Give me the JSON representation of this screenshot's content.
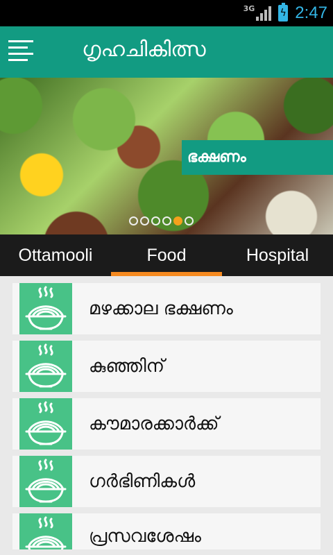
{
  "status_bar": {
    "network": "3G",
    "time": "2:47",
    "icons": [
      "signal-icon",
      "battery-charging-icon"
    ]
  },
  "app_bar": {
    "title": "ഗൃഹചികിത്സ",
    "menu_icon": "hamburger-menu-icon",
    "color": "#129b82"
  },
  "banner": {
    "tag": "ഭക്ഷണം",
    "slide_count": 6,
    "active_slide": 5
  },
  "tabs": [
    {
      "label": "Ottamooli",
      "active": false
    },
    {
      "label": "Food",
      "active": true
    },
    {
      "label": "Hospital",
      "active": false
    }
  ],
  "accent": "#f58a20",
  "list": [
    {
      "label": "മഴക്കാല ഭക്ഷണം",
      "icon": "food-bowl-icon"
    },
    {
      "label": "കുഞ്ഞിന്",
      "icon": "food-bowl-icon"
    },
    {
      "label": "കൗമാരക്കാർക്ക്",
      "icon": "food-bowl-icon"
    },
    {
      "label": "ഗർഭിണികൾ",
      "icon": "food-bowl-icon"
    },
    {
      "label": "പ്രസവശേഷം",
      "icon": "food-bowl-icon"
    }
  ]
}
